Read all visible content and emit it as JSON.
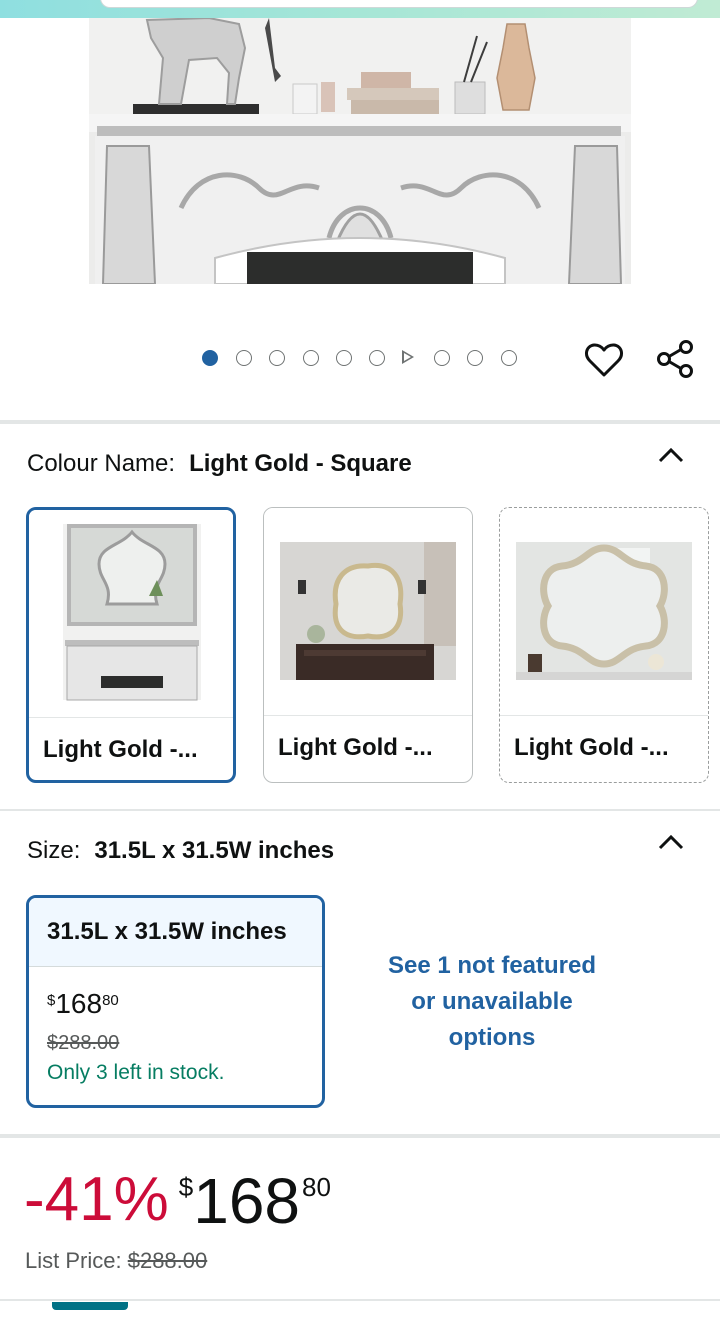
{
  "gallery": {
    "dot_count": 10,
    "active_index": 0,
    "video_index": 6
  },
  "colour": {
    "label": "Colour Name:",
    "selected": "Light Gold - Square",
    "options": [
      {
        "label": "Light Gold -..."
      },
      {
        "label": "Light Gold -..."
      },
      {
        "label": "Light Gold -..."
      }
    ]
  },
  "size": {
    "label": "Size:",
    "selected": "31.5L x 31.5W inches",
    "card": {
      "title": "31.5L x 31.5W inches",
      "price_symbol": "$",
      "price_whole": "168",
      "price_fraction": "80",
      "list_price": "$288.00",
      "stock": "Only 3 left in stock."
    },
    "unavailable_link": "See 1 not featured or unavailable options"
  },
  "price": {
    "discount": "-41%",
    "symbol": "$",
    "whole": "168",
    "fraction": "80",
    "list_label": "List Price:",
    "list_value": "$288.00"
  },
  "colors": {
    "accent_blue": "#2162a1",
    "discount_red": "#cc0c39",
    "stock_green": "#067d62"
  }
}
